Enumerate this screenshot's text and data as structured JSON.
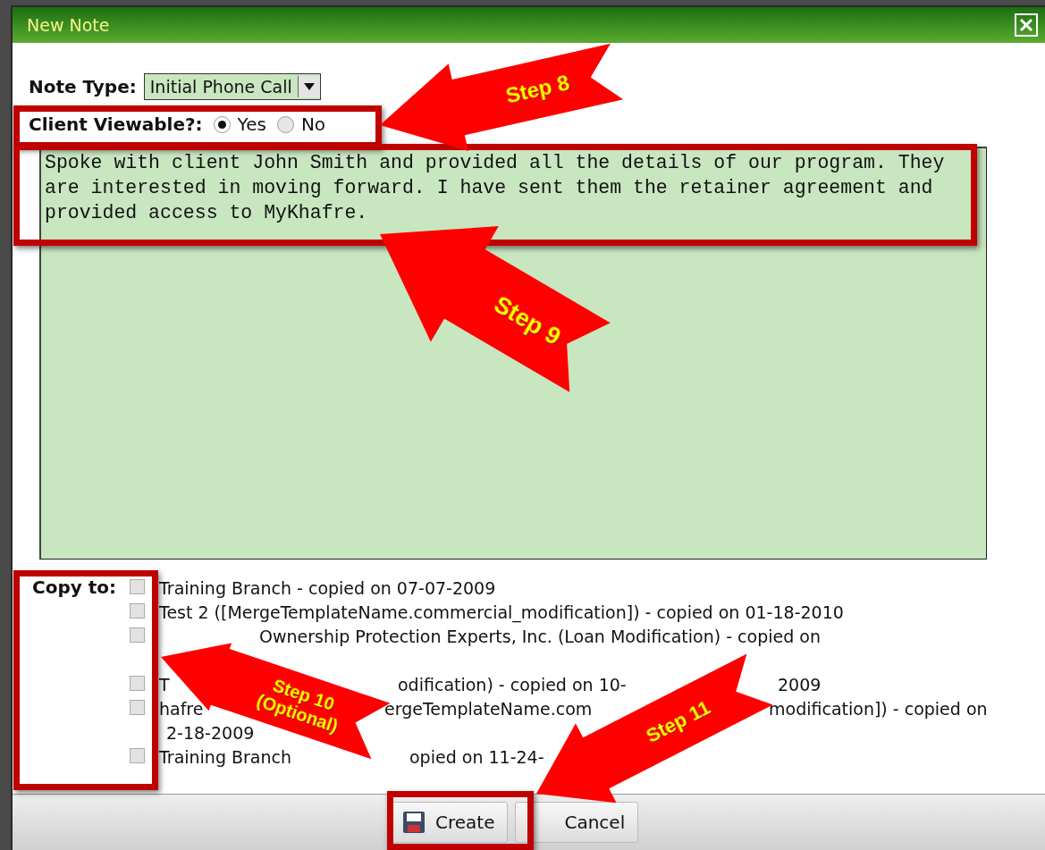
{
  "window": {
    "title": "New Note"
  },
  "note_type": {
    "label": "Note Type:",
    "value": "Initial Phone Call"
  },
  "client_viewable": {
    "label": "Client Viewable?:",
    "options": [
      {
        "label": "Yes",
        "selected": true
      },
      {
        "label": "No",
        "selected": false
      }
    ]
  },
  "note_text": "Spoke with client John Smith and provided all the details of our program. They are interested in moving forward. I have sent them the retainer agreement and provided access to MyKhafre.",
  "copy_to": {
    "label": "Copy to:",
    "items": [
      {
        "checked": false,
        "lines": [
          [
            "Training Branch - copied on 07-07-2009"
          ]
        ]
      },
      {
        "checked": false,
        "lines": [
          [
            "Test 2 ([MergeTemplateName.commercial_modification]) - copied on 01-18-2010"
          ]
        ]
      },
      {
        "checked": false,
        "lines": [
          [
            "Ownership Protection Experts, Inc. (Loan Modification) - copied on"
          ]
        ]
      },
      {
        "checked": false,
        "lines": [
          [
            "T",
            "odification) - copied on 10-",
            "2009"
          ]
        ]
      },
      {
        "checked": false,
        "lines": [
          [
            "hafre",
            "ergeTemplateName.com",
            "modification]) - copied on"
          ],
          [
            "2-18-2009"
          ]
        ]
      },
      {
        "checked": false,
        "lines": [
          [
            "Training Branch",
            "opied on 11-24-"
          ]
        ]
      }
    ]
  },
  "buttons": [
    {
      "kind": "create",
      "label": "Create"
    },
    {
      "kind": "cancel",
      "label": "Cancel"
    }
  ],
  "annotations": [
    {
      "lines": [
        "Step 8"
      ]
    },
    {
      "lines": [
        "Step 9"
      ]
    },
    {
      "lines": [
        "Step 10",
        "(Optional)"
      ]
    },
    {
      "lines": [
        "Step 11"
      ]
    }
  ]
}
